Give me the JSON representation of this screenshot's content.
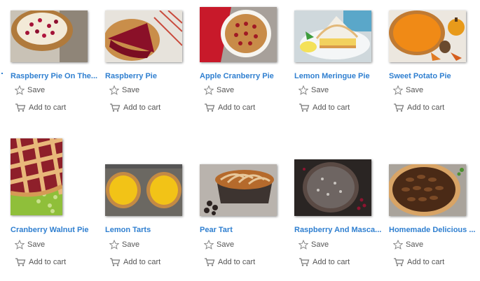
{
  "actions": {
    "save_label": "Save",
    "cart_label": "Add to cart"
  },
  "products": [
    {
      "title": "Raspberry Pie On The...",
      "thumb": "raspberry-cream-pie"
    },
    {
      "title": "Raspberry Pie",
      "thumb": "raspberry-pie-slice"
    },
    {
      "title": "Apple Cranberry Pie",
      "thumb": "heart-lattice-pie"
    },
    {
      "title": "Lemon Meringue Pie",
      "thumb": "lemon-meringue-slice"
    },
    {
      "title": "Sweet Potato Pie",
      "thumb": "sweet-potato-pie"
    },
    {
      "title": "Cranberry Walnut Pie",
      "thumb": "lattice-pie"
    },
    {
      "title": "Lemon Tarts",
      "thumb": "lemon-tarts"
    },
    {
      "title": "Pear Tart",
      "thumb": "pear-tart"
    },
    {
      "title": "Raspberry And Masca...",
      "thumb": "dark-berry-pie"
    },
    {
      "title": "Homemade Delicious ...",
      "thumb": "pecan-pie"
    }
  ],
  "colors": {
    "link": "#2f7fd0",
    "action_text": "#555555"
  }
}
